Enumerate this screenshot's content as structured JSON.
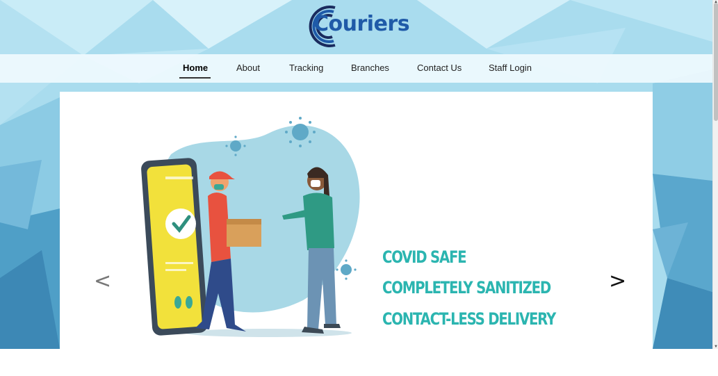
{
  "brand": {
    "name": "Couriers",
    "logo_icon": "concentric-c-logo",
    "color": "#1f5aa8"
  },
  "nav": {
    "items": [
      {
        "label": "Home",
        "active": true
      },
      {
        "label": "About"
      },
      {
        "label": "Tracking"
      },
      {
        "label": "Branches"
      },
      {
        "label": "Contact Us"
      },
      {
        "label": "Staff Login"
      }
    ]
  },
  "carousel": {
    "prev_label": "<",
    "next_label": ">",
    "slide": {
      "lines": [
        "COVID SAFE",
        "COMPLETELY SANITIZED",
        "CONTACT-LESS DELIVERY"
      ],
      "text_color": "#2bb5b0"
    }
  },
  "colors": {
    "background": "#9fd6ea",
    "navbar": "#eef8fc",
    "accent": "#2bb5b0"
  }
}
